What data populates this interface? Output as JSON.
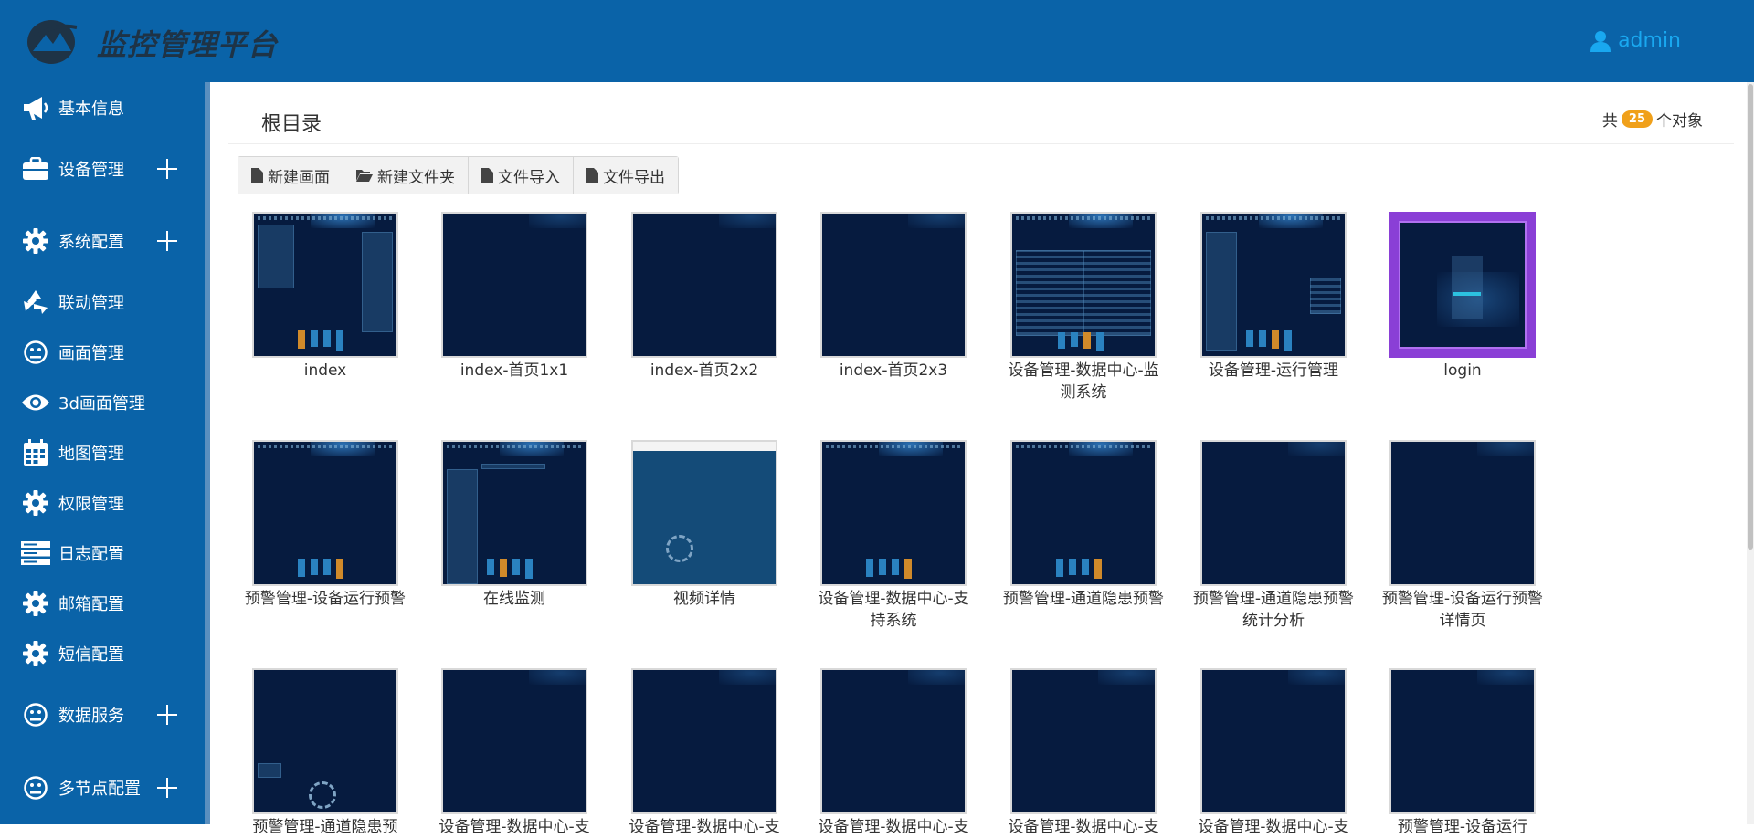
{
  "app": {
    "title": "监控管理平台",
    "user": "admin"
  },
  "sidebar": {
    "items": [
      {
        "label": "基本信息",
        "icon": "megaphone-icon",
        "expandable": false
      },
      {
        "label": "设备管理",
        "icon": "briefcase-icon",
        "expandable": true
      },
      {
        "label": "系统配置",
        "icon": "gear-icon",
        "expandable": true
      },
      {
        "label": "联动管理",
        "icon": "recycle-icon",
        "expandable": false
      },
      {
        "label": "画面管理",
        "icon": "face-icon",
        "expandable": false
      },
      {
        "label": "3d画面管理",
        "icon": "eye-icon",
        "expandable": false
      },
      {
        "label": "地图管理",
        "icon": "calendar-icon",
        "expandable": false
      },
      {
        "label": "权限管理",
        "icon": "gear-icon",
        "expandable": false
      },
      {
        "label": "日志配置",
        "icon": "server-icon",
        "expandable": false
      },
      {
        "label": "邮箱配置",
        "icon": "gear-icon",
        "expandable": false
      },
      {
        "label": "短信配置",
        "icon": "gear-icon",
        "expandable": false
      },
      {
        "label": "数据服务",
        "icon": "face-icon",
        "expandable": true
      },
      {
        "label": "多节点配置",
        "icon": "face-icon",
        "expandable": true
      }
    ]
  },
  "main": {
    "breadcrumb": "根目录",
    "count_prefix": "共",
    "count": "25",
    "count_suffix": "个对象",
    "toolbar": {
      "new_screen": "新建画面",
      "new_folder": "新建文件夹",
      "import": "文件导入",
      "export": "文件导出"
    },
    "tiles": [
      {
        "label": "index",
        "style": "dashboard"
      },
      {
        "label": "index-首页1x1",
        "style": "blank"
      },
      {
        "label": "index-首页2x2",
        "style": "blank"
      },
      {
        "label": "index-首页2x3",
        "style": "blank"
      },
      {
        "label": "设备管理-数据中心-监测系统",
        "style": "grid"
      },
      {
        "label": "设备管理-运行管理",
        "style": "dashboard2"
      },
      {
        "label": "login",
        "style": "login",
        "selected": true
      },
      {
        "label": "预警管理-设备运行预警",
        "style": "bars"
      },
      {
        "label": "在线监测",
        "style": "dashboard3"
      },
      {
        "label": "视频详情",
        "style": "light"
      },
      {
        "label": "设备管理-数据中心-支持系统",
        "style": "bars"
      },
      {
        "label": "预警管理-通道隐患预警",
        "style": "bars"
      },
      {
        "label": "预警管理-通道隐患预警统计分析",
        "style": "blank"
      },
      {
        "label": "预警管理-设备运行预警详情页",
        "style": "blank"
      },
      {
        "label": "预警管理-通道隐患预",
        "style": "ring"
      },
      {
        "label": "设备管理-数据中心-支",
        "style": "blank"
      },
      {
        "label": "设备管理-数据中心-支",
        "style": "blank"
      },
      {
        "label": "设备管理-数据中心-支",
        "style": "blank"
      },
      {
        "label": "设备管理-数据中心-支",
        "style": "blank"
      },
      {
        "label": "设备管理-数据中心-支",
        "style": "blank"
      },
      {
        "label": "预警管理-设备运行",
        "style": "blank"
      }
    ]
  },
  "colors": {
    "header": "#0a63a8",
    "sidebar": "#0a63a8",
    "badge": "#f0a01a",
    "selected": "#8a3fd6",
    "user": "#19a8f0"
  }
}
